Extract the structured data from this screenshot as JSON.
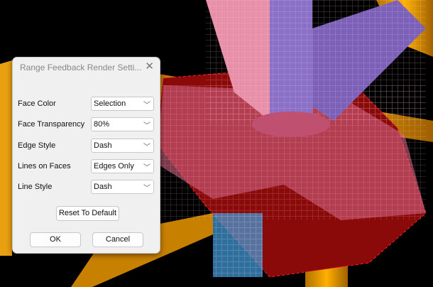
{
  "dialog": {
    "title": "Range Feedback Render Setti...",
    "close_icon": "close-icon",
    "fields": [
      {
        "label": "Face Color",
        "value": "Selection"
      },
      {
        "label": "Face Transparency",
        "value": "80%"
      },
      {
        "label": "Edge Style",
        "value": "Dash"
      },
      {
        "label": "Lines on Faces",
        "value": "Edges Only"
      },
      {
        "label": "Line Style",
        "value": "Dash"
      }
    ],
    "reset_label": "Reset To Default",
    "ok_label": "OK",
    "cancel_label": "Cancel"
  },
  "colors": {
    "beam": "#e8a010",
    "mesh_pink": "#f0a0b8",
    "mesh_purple": "#8a70c8",
    "face_red": "#a01010"
  }
}
